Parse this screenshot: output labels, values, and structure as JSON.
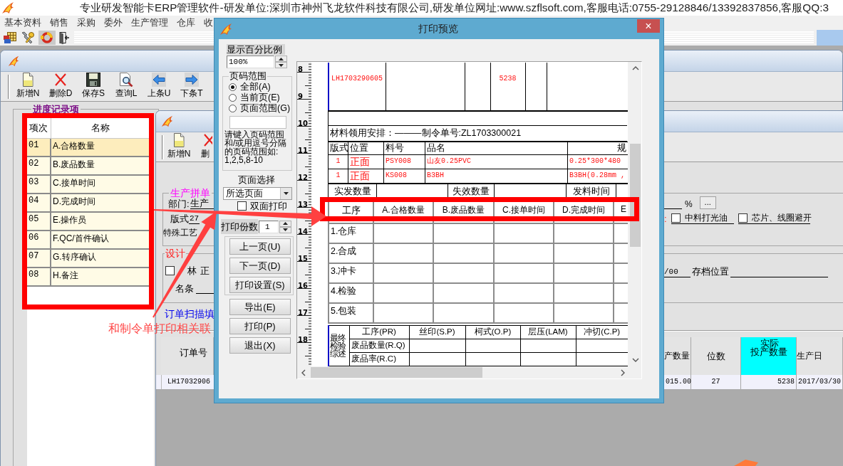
{
  "app": {
    "title": "专业研发智能卡ERP管理软件-研发单位:深圳市神州飞龙软件科技有限公司,研发单位网址:www.szflsoft.com,客服电话:0755-29128846/13392837856,客服QQ:3",
    "menu": [
      "基本资料",
      "销售",
      "采购",
      "委外",
      "生产管理",
      "仓库",
      "收"
    ]
  },
  "progress_window": {
    "toolbar": [
      "新增N",
      "删除D",
      "保存S",
      "查询L",
      "上条U",
      "下条T"
    ],
    "group_title": "进度记录项",
    "columns": [
      "项次",
      "名称"
    ],
    "rows": [
      {
        "no": "01",
        "name": "A.合格数量",
        "selected": true
      },
      {
        "no": "02",
        "name": "B.废品数量",
        "selected": false
      },
      {
        "no": "03",
        "name": "C.接单时间",
        "selected": false
      },
      {
        "no": "04",
        "name": "D.完成时间",
        "selected": false
      },
      {
        "no": "05",
        "name": "E.操作员",
        "selected": false
      },
      {
        "no": "06",
        "name": "F.QC/首件确认",
        "selected": false
      },
      {
        "no": "07",
        "name": "G.转序确认",
        "selected": false
      },
      {
        "no": "08",
        "name": "H.备注",
        "selected": false
      }
    ]
  },
  "order_window": {
    "toolbar": [
      "新增N",
      "删"
    ],
    "production": {
      "title": "生产拼单",
      "department_label": "部门:",
      "department": "生产",
      "format_label": "版式",
      "format": "27",
      "craft_label": "特殊工艺",
      "percent_sign": "%",
      "more_button": "...",
      "note_label": ":",
      "options": [
        {
          "label": "中料打光油",
          "checked": false
        },
        {
          "label": "芯片、线圈避开",
          "checked": false
        }
      ]
    },
    "design": {
      "title": "设计",
      "film": {
        "label": "林",
        "checked": false
      },
      "side": "正",
      "signature_label": "名条",
      "ratio": "/00",
      "archive_label": "存档位置"
    },
    "scan_link": "订单扫描填",
    "grid": {
      "left_columns": [
        {
          "label": "订单号",
          "highlighted": false
        }
      ],
      "right_columns": [
        {
          "label": "产数量",
          "highlighted": false
        },
        {
          "label": "位数",
          "highlighted": false
        },
        {
          "label": "实际投产数量",
          "highlighted": true
        },
        {
          "label": "生产日",
          "highlighted": false
        }
      ],
      "left_cells": [
        "LH17032906"
      ],
      "right_cells": [
        "015.00",
        "27",
        "5238",
        "2017/03/30"
      ]
    }
  },
  "print_preview": {
    "title": "打印预览",
    "close_label": "×",
    "zoom_label": "显示百分比例",
    "zoom_value": "100%",
    "page_range": {
      "title": "页码范围",
      "options": [
        {
          "label": "全部(A)",
          "selected": true
        },
        {
          "label": "当前页(E)",
          "selected": false
        },
        {
          "label": "页面范围(G)",
          "selected": false
        }
      ],
      "hint": "请键入页码范围和/或用逗号分隔的页码范围如:1,2,5,8-10"
    },
    "page_select_label": "页面选择",
    "page_select_value": "所选页面",
    "duplex": {
      "label": "双面打印",
      "checked": false
    },
    "copies_label": "打印份数",
    "copies": "1",
    "nav_buttons": [
      "上一页(U)",
      "下一页(D)",
      "打印设置(S)"
    ],
    "action_buttons": [
      "导出(E)",
      "打印(P)",
      "退出(X)"
    ],
    "ruler": [
      "8",
      "9",
      "10",
      "11",
      "12",
      "13",
      "14",
      "15",
      "16",
      "17",
      "18"
    ],
    "page": {
      "order_no": "LH1703290605",
      "quantity": "5238",
      "material_heading": "材料领用安排：———制令单号:ZL1703300021",
      "material_columns": [
        "版式",
        "位置",
        "料号",
        "品名",
        "规"
      ],
      "material_rows": [
        [
          "1",
          "正面",
          "PSY008",
          "山友0.25PVC",
          "0.25*300*480"
        ],
        [
          "1",
          "正面",
          "KS008",
          "B3BH",
          "B3BH(0.28mm ,"
        ]
      ],
      "issue_labels": [
        "实发数量",
        "失效数量",
        "发料时间"
      ],
      "process_columns": [
        "工序",
        "A.合格数量",
        "B.废品数量",
        "C.接单时间",
        "D.完成时间",
        "E"
      ],
      "process_rows": [
        "1.仓库",
        "2.合成",
        "3.冲卡",
        "4.检验",
        "5.包装"
      ],
      "final_check": {
        "title": "最终检验综述",
        "columns": [
          "工序(PR)",
          "丝印(S.P)",
          "柯式(O.P)",
          "层压(LAM)",
          "冲切(C.P)"
        ],
        "rows": [
          "废品数量(R.Q)",
          "废品率(R.C)"
        ]
      }
    }
  },
  "annotation": {
    "text": "和制令单打印相关联"
  }
}
